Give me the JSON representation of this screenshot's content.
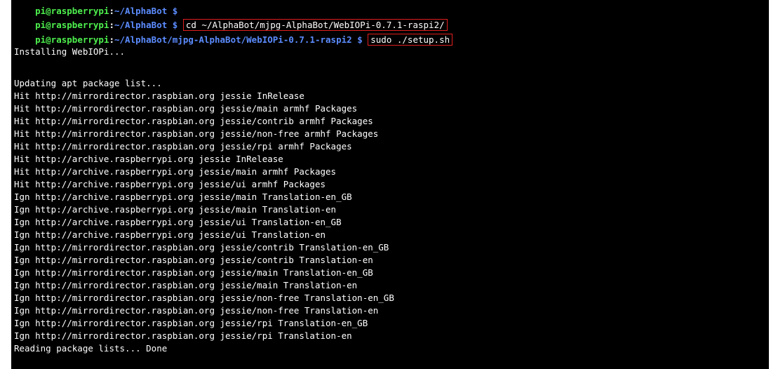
{
  "colors": {
    "background": "#000000",
    "output_text": "#ffffff",
    "prompt_user": "#4ef04e",
    "prompt_path": "#5c8cff",
    "highlight_border": "#e02020"
  },
  "top_cut_line": {
    "user_host": "pi@raspberrypi",
    "path": "~/AlphaBot",
    "dollar": "$",
    "command": "cd ~/AlphaBot/mjpg-AlphaBot/WebIOPi-0.7.1-raspi2/ $"
  },
  "prompt1": {
    "user_host": "pi@raspberrypi",
    "sep": ":",
    "path": "~/AlphaBot",
    "dollar": "$",
    "command": "cd ~/AlphaBot/mjpg-AlphaBot/WebIOPi-0.7.1-raspi2/"
  },
  "prompt2": {
    "user_host": "pi@raspberrypi",
    "sep": ":",
    "path": "~/AlphaBot/mjpg-AlphaBot/WebIOPi-0.7.1-raspi2",
    "dollar": "$",
    "command": "sudo ./setup.sh"
  },
  "output_lines": [
    "",
    "Installing WebIOPi...",
    "",
    "Updating apt package list...",
    "Hit http://mirrordirector.raspbian.org jessie InRelease",
    "Hit http://mirrordirector.raspbian.org jessie/main armhf Packages",
    "Hit http://mirrordirector.raspbian.org jessie/contrib armhf Packages",
    "Hit http://mirrordirector.raspbian.org jessie/non-free armhf Packages",
    "Hit http://mirrordirector.raspbian.org jessie/rpi armhf Packages",
    "Hit http://archive.raspberrypi.org jessie InRelease",
    "Hit http://archive.raspberrypi.org jessie/main armhf Packages",
    "Hit http://archive.raspberrypi.org jessie/ui armhf Packages",
    "Ign http://archive.raspberrypi.org jessie/main Translation-en_GB",
    "Ign http://archive.raspberrypi.org jessie/main Translation-en",
    "Ign http://archive.raspberrypi.org jessie/ui Translation-en_GB",
    "Ign http://archive.raspberrypi.org jessie/ui Translation-en",
    "Ign http://mirrordirector.raspbian.org jessie/contrib Translation-en_GB",
    "Ign http://mirrordirector.raspbian.org jessie/contrib Translation-en",
    "Ign http://mirrordirector.raspbian.org jessie/main Translation-en_GB",
    "Ign http://mirrordirector.raspbian.org jessie/main Translation-en",
    "Ign http://mirrordirector.raspbian.org jessie/non-free Translation-en_GB",
    "Ign http://mirrordirector.raspbian.org jessie/non-free Translation-en",
    "Ign http://mirrordirector.raspbian.org jessie/rpi Translation-en_GB",
    "Ign http://mirrordirector.raspbian.org jessie/rpi Translation-en",
    "Reading package lists... Done"
  ]
}
